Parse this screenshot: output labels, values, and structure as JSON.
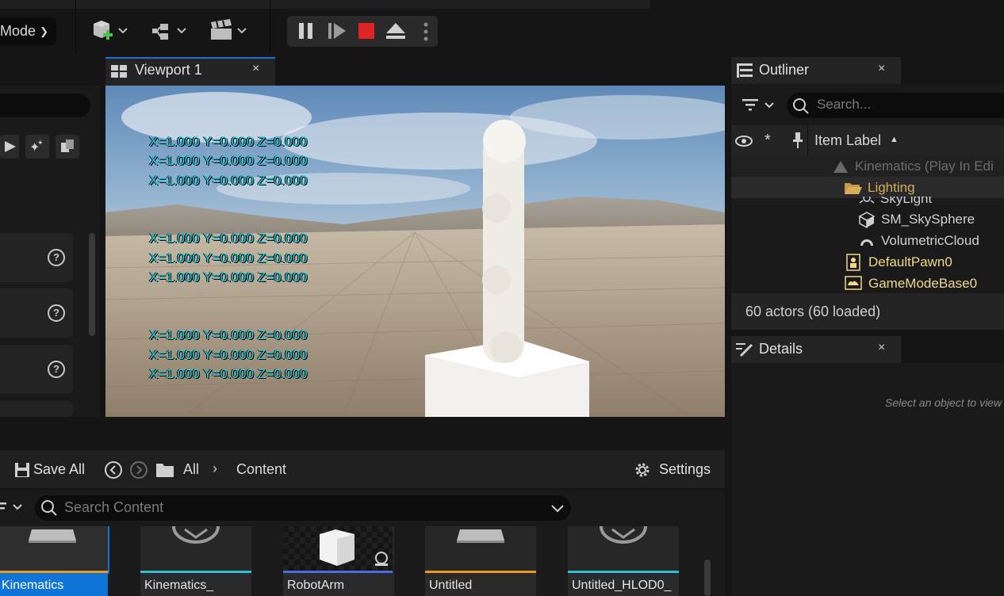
{
  "toolbar": {
    "mode_label": "Mode"
  },
  "viewport": {
    "tab_title": "Viewport 1",
    "close": "×",
    "debug_lines": [
      "X=1.000 Y=0.000 Z=0.000",
      "X=1.000 Y=0.000 Z=0.000",
      "X=1.000 Y=0.000 Z=0.000",
      "X=1.000 Y=0.000 Z=0.000",
      "X=1.000 Y=0.000 Z=0.000",
      "X=1.000 Y=0.000 Z=0.000",
      "X=1.000 Y=0.000 Z=0.000",
      "X=1.000 Y=0.000 Z=0.000",
      "X=1.000 Y=0.000 Z=0.000"
    ]
  },
  "outliner": {
    "title": "Outliner",
    "close": "×",
    "search_placeholder": "Search...",
    "column_label": "Item Label",
    "items": [
      {
        "label": "Kinematics (Play In Edi"
      },
      {
        "label": "Lighting"
      },
      {
        "label": "SkyLight"
      },
      {
        "label": "SM_SkySphere"
      },
      {
        "label": "VolumetricCloud"
      },
      {
        "label": "DefaultPawn0"
      },
      {
        "label": "GameModeBase0"
      }
    ],
    "status": "60 actors (60 loaded)"
  },
  "details": {
    "title": "Details",
    "close": "×",
    "empty_text": "Select an object to view"
  },
  "content_browser": {
    "save_all": "Save All",
    "path_all": "All",
    "path_content": "Content",
    "settings": "Settings",
    "search_placeholder": "Search Content",
    "assets": [
      {
        "label": "Kinematics"
      },
      {
        "label": "Kinematics_"
      },
      {
        "label": "RobotArm"
      },
      {
        "label": "Untitled"
      },
      {
        "label": "Untitled_HLOD0_"
      }
    ]
  },
  "colors": {
    "accent_blue": "#1d6fd0",
    "selected_asset": "#0f74d8",
    "coord_text": "#22d4e6",
    "folder_yellow": "#d7ad5b",
    "pawn_yellow": "#f0d78a",
    "stop_red": "#e02424",
    "asset_orange": "#e69b1e",
    "asset_cyan": "#2ec2d2",
    "asset_blue": "#4a6ee0"
  }
}
